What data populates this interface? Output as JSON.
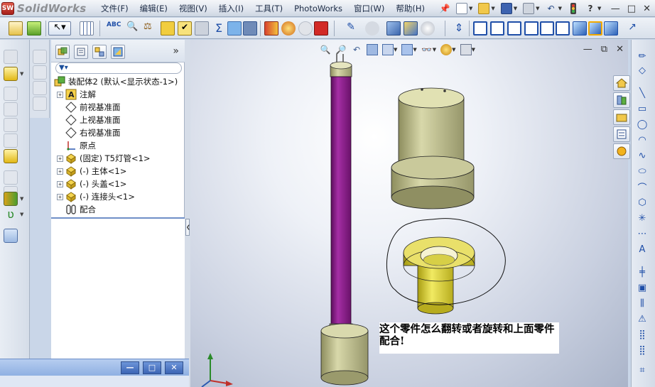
{
  "app": {
    "name": "SolidWorks",
    "logo_mark": "SW"
  },
  "menu": [
    "文件(F)",
    "编辑(E)",
    "视图(V)",
    "插入(I)",
    "工具(T)",
    "PhotoWorks",
    "窗口(W)",
    "帮助(H)"
  ],
  "quick_icons": [
    "pin-icon",
    "new-document-icon",
    "open-folder-icon",
    "save-icon",
    "print-icon",
    "undo-icon",
    "rebuild-icon",
    "help-icon"
  ],
  "window_controls": {
    "minimize": "—",
    "restore": "□",
    "close": "✕"
  },
  "feature_manager": {
    "tabs": [
      "featuremanager-tab",
      "propertymanager-tab",
      "configurationmanager-tab",
      "dimxpert-tab"
    ],
    "more": "»",
    "tree": [
      {
        "label": "装配体2 (默认<显示状态-1>)",
        "icon": "assembly-icon",
        "expander": ""
      },
      {
        "label": "注解",
        "icon": "annotations-icon",
        "expander": "+"
      },
      {
        "label": "前视基准面",
        "icon": "plane-icon",
        "expander": ""
      },
      {
        "label": "上视基准面",
        "icon": "plane-icon",
        "expander": ""
      },
      {
        "label": "右视基准面",
        "icon": "plane-icon",
        "expander": ""
      },
      {
        "label": "原点",
        "icon": "origin-icon",
        "expander": ""
      },
      {
        "label": "(固定) T5灯管<1>",
        "icon": "part-icon",
        "expander": "+"
      },
      {
        "label": "(-) 主体<1>",
        "icon": "part-icon",
        "expander": "+"
      },
      {
        "label": "(-) 头盖<1>",
        "icon": "part-icon",
        "expander": "+"
      },
      {
        "label": "(-) 连接头<1>",
        "icon": "part-icon",
        "expander": "+"
      },
      {
        "label": "配合",
        "icon": "mates-icon",
        "expander": ""
      }
    ]
  },
  "floating_window": {
    "minimize": "—",
    "maximize": "□",
    "close": "✕"
  },
  "viewport": {
    "view_controls": {
      "minimize": "—",
      "restore": "⧉",
      "close": "✕"
    },
    "heads_up_icons": [
      "zoom-fit-icon",
      "zoom-area-icon",
      "previous-view-icon",
      "section-view-icon",
      "view-orientation-icon",
      "display-style-icon",
      "hide-show-icon",
      "edit-appearance-icon",
      "apply-scene-icon"
    ],
    "note": "这个零件怎么翻转或者旋转和上面零件配合!"
  },
  "colors": {
    "tube_purple": "#8e1f8e",
    "part_olive": "#b9b98a",
    "connector_yellow": "#d9d23a",
    "menu_text": "#1b2a44",
    "fm_divider": "#6f8fc7"
  }
}
